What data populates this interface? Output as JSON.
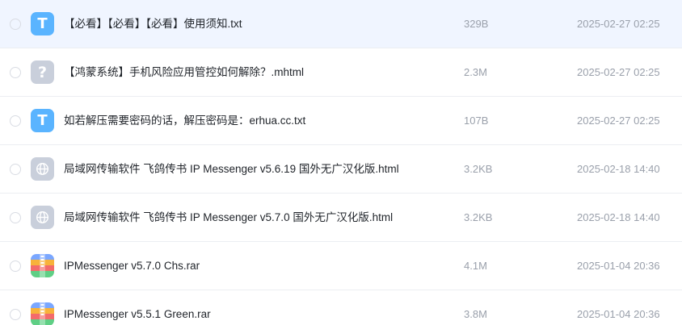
{
  "files": [
    {
      "name": "【必看】【必看】【必看】使用须知.txt",
      "size": "329B",
      "date": "2025-02-27 02:25",
      "icon": "txt-file-icon",
      "glyph": "T"
    },
    {
      "name": "【鸿蒙系统】手机风险应用管控如何解除？.mhtml",
      "size": "2.3M",
      "date": "2025-02-27 02:25",
      "icon": "unknown-file-icon",
      "glyph": "?"
    },
    {
      "name": "如若解压需要密码的话，解压密码是：erhua.cc.txt",
      "size": "107B",
      "date": "2025-02-27 02:25",
      "icon": "txt-file-icon",
      "glyph": "T"
    },
    {
      "name": "局域网传输软件 飞鸽传书 IP Messenger v5.6.19 国外无广汉化版.html",
      "size": "3.2KB",
      "date": "2025-02-18 14:40",
      "icon": "html-file-icon",
      "glyph": ""
    },
    {
      "name": "局域网传输软件 飞鸽传书 IP Messenger v5.7.0 国外无广汉化版.html",
      "size": "3.2KB",
      "date": "2025-02-18 14:40",
      "icon": "html-file-icon",
      "glyph": ""
    },
    {
      "name": "IPMessenger v5.7.0 Chs.rar",
      "size": "4.1M",
      "date": "2025-01-04 20:36",
      "icon": "archive-file-icon",
      "glyph": ""
    },
    {
      "name": "IPMessenger v5.5.1 Green.rar",
      "size": "3.8M",
      "date": "2025-01-04 20:36",
      "icon": "archive-file-icon",
      "glyph": ""
    }
  ],
  "colors": {
    "selected_row": "#f0f5ff",
    "txt_icon": "#5ab4ff",
    "generic_icon": "#c9cfdb",
    "text": "#1f2329",
    "muted": "#9aa0ab"
  }
}
